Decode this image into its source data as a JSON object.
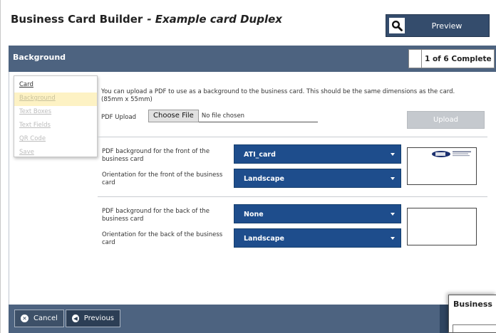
{
  "header": {
    "title": "Business Card Builder",
    "subtitle": "- Example card Duplex",
    "preview_label": "Preview",
    "preview_icon": "search-icon"
  },
  "section": {
    "title": "Background",
    "progress": "1 of 6 Complete"
  },
  "steps": [
    {
      "label": "Card",
      "state": "link"
    },
    {
      "label": "Background",
      "state": "active"
    },
    {
      "label": "Text Boxes",
      "state": "disabled"
    },
    {
      "label": "Text Fields",
      "state": "disabled"
    },
    {
      "label": "QR Code",
      "state": "disabled"
    },
    {
      "label": "Save",
      "state": "disabled"
    }
  ],
  "upload": {
    "note": "You can upload a PDF to use as a background to the business card. This should be the same dimensions as the card. (85mm x 55mm)",
    "label": "PDF Upload",
    "choose_label": "Choose File",
    "file_status": "No file chosen",
    "upload_label": "Upload"
  },
  "front": {
    "pdf_label": "PDF background for the front of the business card",
    "pdf_value": "ATI_card",
    "orientation_label": "Orientation for the front of the business card",
    "orientation_value": "Landscape"
  },
  "back": {
    "pdf_label": "PDF background for the back of the business card",
    "pdf_value": "None",
    "orientation_label": "Orientation for the back of the business card",
    "orientation_value": "Landscape"
  },
  "footer": {
    "cancel_label": "Cancel",
    "cancel_icon": "close-icon",
    "previous_label": "Previous",
    "previous_icon": "chevron-left-icon"
  },
  "popup": {
    "title": "Business"
  },
  "colors": {
    "header_bar": "#4d6380",
    "select": "#1e4d8c",
    "preview_button": "#344c6c",
    "active_step": "#fdf2c4"
  }
}
